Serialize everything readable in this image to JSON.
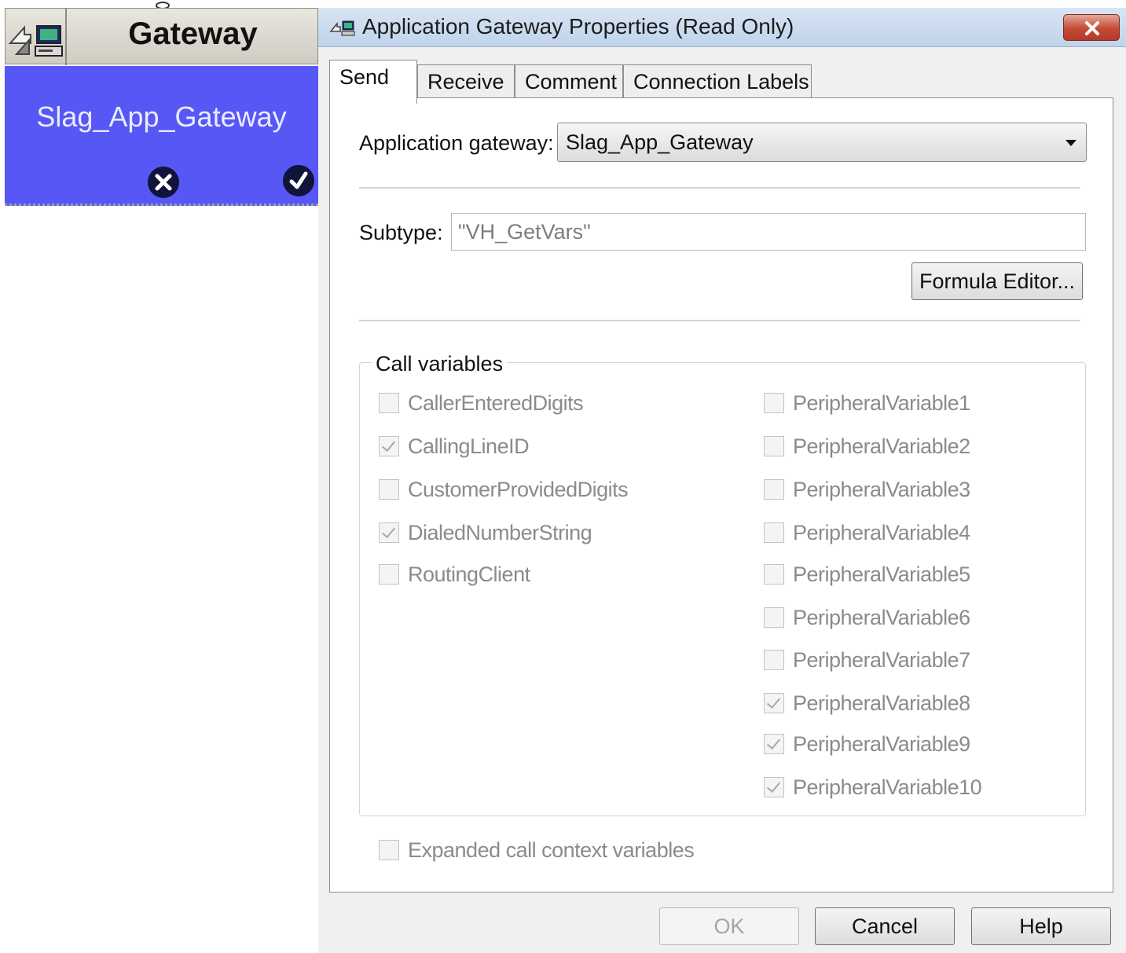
{
  "node": {
    "title": "Gateway",
    "label": "Slag_App_Gateway"
  },
  "dialog": {
    "title": "Application Gateway Properties (Read Only)",
    "tabs": [
      "Send",
      "Receive",
      "Comment",
      "Connection Labels"
    ],
    "active_tab": "Send",
    "application_gateway_label": "Application gateway:",
    "application_gateway_value": "Slag_App_Gateway",
    "subtype_label": "Subtype:",
    "subtype_value": "\"VH_GetVars\"",
    "formula_editor_label": "Formula Editor...",
    "call_variables_title": "Call variables",
    "left_vars": [
      {
        "label": "CallerEnteredDigits",
        "checked": false
      },
      {
        "label": "CallingLineID",
        "checked": true
      },
      {
        "label": "CustomerProvidedDigits",
        "checked": false
      },
      {
        "label": "DialedNumberString",
        "checked": true
      },
      {
        "label": "RoutingClient",
        "checked": false
      }
    ],
    "right_vars": [
      {
        "label": "PeripheralVariable1",
        "checked": false
      },
      {
        "label": "PeripheralVariable2",
        "checked": false
      },
      {
        "label": "PeripheralVariable3",
        "checked": false
      },
      {
        "label": "PeripheralVariable4",
        "checked": false
      },
      {
        "label": "PeripheralVariable5",
        "checked": false
      },
      {
        "label": "PeripheralVariable6",
        "checked": false
      },
      {
        "label": "PeripheralVariable7",
        "checked": false
      },
      {
        "label": "PeripheralVariable8",
        "checked": true
      },
      {
        "label": "PeripheralVariable9",
        "checked": true
      },
      {
        "label": "PeripheralVariable10",
        "checked": true
      }
    ],
    "expanded_label": "Expanded call context variables",
    "expanded_checked": false,
    "ok_label": "OK",
    "cancel_label": "Cancel",
    "help_label": "Help"
  },
  "colors": {
    "node_blue": "#5757f6",
    "close_red": "#c24a36"
  }
}
